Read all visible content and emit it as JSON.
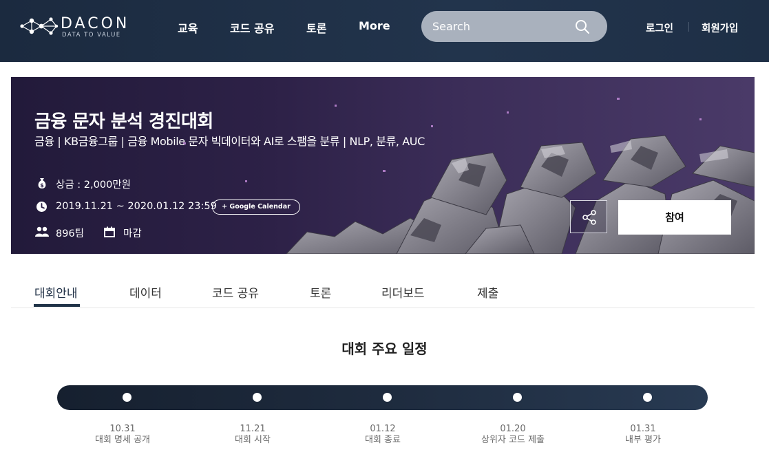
{
  "header": {
    "logo_text": "DACON",
    "logo_sub": "DATA TO VALUE",
    "nav": [
      "교육",
      "코드 공유",
      "토론",
      "More"
    ],
    "search_placeholder": "Search",
    "login": "로그인",
    "signup": "회원가입"
  },
  "banner": {
    "title": "금융 문자 분석 경진대회",
    "subtitle": "금융 | KB금융그룹 | 금융 Mobile 문자 빅데이터와 AI로 스팸을 분류 | NLP, 분류, AUC",
    "prize": "상금 : 2,000만원",
    "period": "2019.11.21 ~ 2020.01.12 23:59",
    "calendar_btn": "+ Google Calendar",
    "teams": "896팀",
    "status": "마감",
    "join_btn": "참여"
  },
  "tabs": [
    "대회안내",
    "데이터",
    "코드 공유",
    "토론",
    "리더보드",
    "제출"
  ],
  "schedule": {
    "title": "대회 주요 일정",
    "milestones": [
      {
        "date": "10.31",
        "label": "대회 명세 공개"
      },
      {
        "date": "11.21",
        "label": "대회 시작"
      },
      {
        "date": "01.12",
        "label": "대회 종료"
      },
      {
        "date": "01.20",
        "label": "상위자 코드 제출"
      },
      {
        "date": "01.31",
        "label": "내부 평가"
      }
    ]
  },
  "colors": {
    "header_bg": "#1e2f46",
    "timeline_bg": "#1e2b3e",
    "active_tab_underline": "#1f3247"
  }
}
